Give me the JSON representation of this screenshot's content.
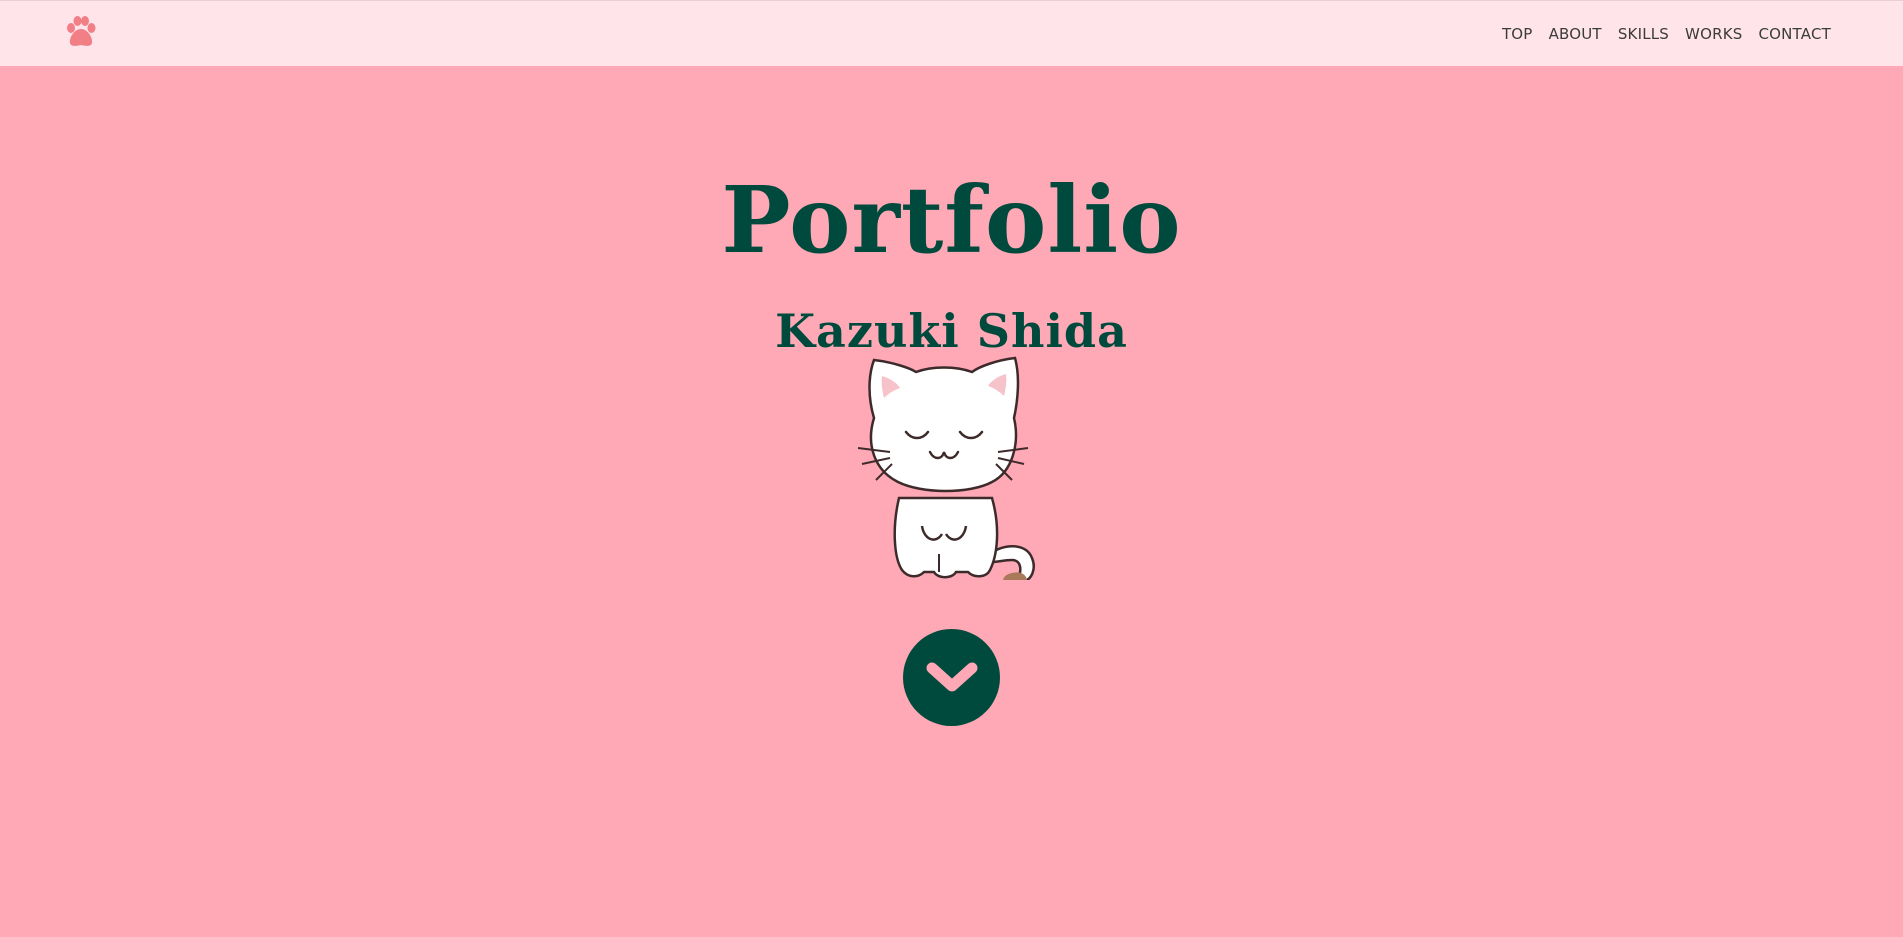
{
  "header": {
    "logo_icon": "paw-icon",
    "nav": [
      {
        "label": "TOP"
      },
      {
        "label": "ABOUT"
      },
      {
        "label": "SKILLS"
      },
      {
        "label": "WORKS"
      },
      {
        "label": "CONTACT"
      }
    ]
  },
  "hero": {
    "title": "Portfolio",
    "subtitle": "Kazuki Shida",
    "illustration": "cat-illustration",
    "scroll_icon": "chevron-down-icon"
  },
  "colors": {
    "background": "#ffa8b6",
    "header_background": "#ffe5ea",
    "accent": "#004a3d",
    "logo": "#f27f86"
  }
}
